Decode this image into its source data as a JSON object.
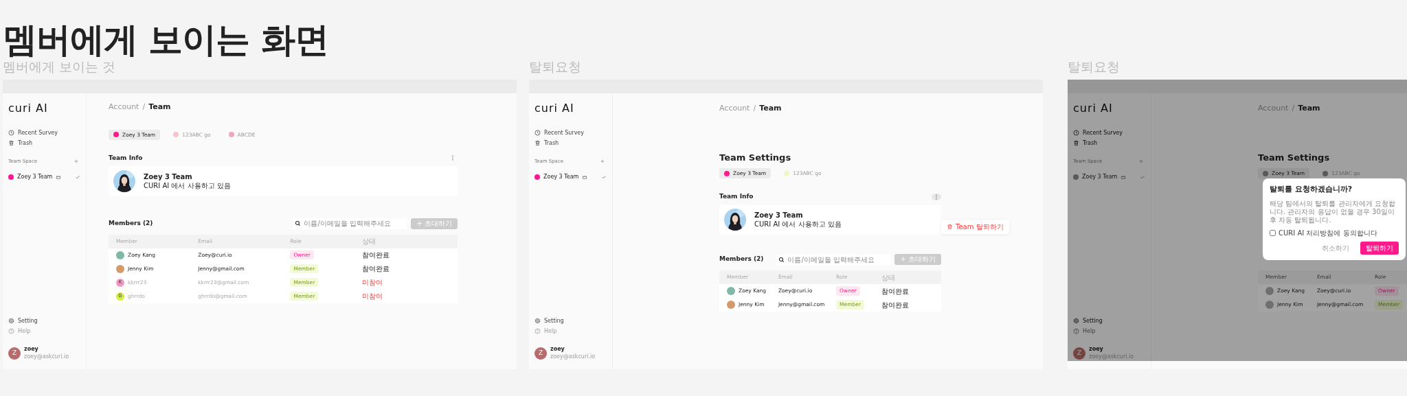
{
  "page_title": "멤버에게 보이는 화면",
  "boards": [
    {
      "label": "멤버에게 보이는 것",
      "app": {
        "sidebar": {
          "logo": "curi AI",
          "nav": [
            {
              "label": "Recent Survey",
              "kind": "clock"
            },
            {
              "label": "Trash",
              "kind": "trash"
            }
          ],
          "team_space": {
            "label": "Team Space",
            "teams": [
              {
                "name": "Zoey 3 Team",
                "color": "#ff1493",
                "owner": true,
                "selected": true
              }
            ]
          },
          "footer": [
            {
              "label": "Setting",
              "kind": "gear",
              "disabled": false
            },
            {
              "label": "Help",
              "kind": "help",
              "disabled": true
            }
          ],
          "user": {
            "initial": "Z",
            "name": "zoey",
            "email": "zoey@askcuri.io"
          }
        },
        "breadcrumb": {
          "items": [
            "Account",
            "Team"
          ],
          "separator": "/"
        },
        "main": {
          "team_tabs": [
            {
              "label": "Zoey 3 Team",
              "color": "#ff1a8c",
              "selected": true
            },
            {
              "label": "123ABC go",
              "color": "#f7c3cd",
              "selected": false
            },
            {
              "label": "ABCDE",
              "color": "#f3a6c4",
              "selected": false
            }
          ],
          "team_info": {
            "label": "Team Info",
            "name": "Zoey 3 Team",
            "description": "CURI AI 에서 사용하고 있음"
          },
          "members": {
            "title": "Members (2)",
            "search": {
              "placeholder": "이름/이메일을 입력해주세요"
            },
            "invite": {
              "label": "+ 초대하기",
              "disabled": true
            },
            "columns": [
              "Member",
              "Email",
              "Role",
              "상태"
            ],
            "rows": [
              {
                "name": "Zoey Kang",
                "email": "Zoey@curi.io",
                "role": {
                  "label": "Owner",
                  "kind": "owner"
                },
                "status": "참여완료",
                "joined": true
              },
              {
                "name": "Jenny Kim",
                "email": "Jenny@gmail.com",
                "role": {
                  "label": "Member",
                  "kind": "member"
                },
                "status": "참여완료",
                "joined": true
              },
              {
                "name": "kkrrr23",
                "email": "kkrrr23@gmail.com",
                "role": {
                  "label": "Member",
                  "kind": "member"
                },
                "status": "미참여",
                "joined": false,
                "avatar": {
                  "kind": "initial",
                  "initial": "K",
                  "color": "#f29ac4"
                }
              },
              {
                "name": "ghrrdo",
                "email": "ghrrdo@gmail.com",
                "role": {
                  "label": "Member",
                  "kind": "member"
                },
                "status": "미참여",
                "joined": false,
                "avatar": {
                  "kind": "initial",
                  "initial": "G",
                  "color": "#d4f03c"
                }
              }
            ]
          }
        }
      }
    },
    {
      "label": "탈퇴요청",
      "app": {
        "sidebar": {
          "logo": "curi AI",
          "nav": [
            {
              "label": "Recent Survey",
              "kind": "clock"
            },
            {
              "label": "Trash",
              "kind": "trash"
            }
          ],
          "team_space": {
            "label": "Team Space",
            "teams": [
              {
                "name": "Zoey 3 Team",
                "color": "#ff1493",
                "owner": true,
                "selected": true
              }
            ]
          },
          "footer": [
            {
              "label": "Setting",
              "kind": "gear",
              "disabled": false
            },
            {
              "label": "Help",
              "kind": "help",
              "disabled": true
            }
          ],
          "user": {
            "initial": "Z",
            "name": "zoey",
            "email": "zoey@askcuri.io"
          }
        },
        "breadcrumb": {
          "items": [
            "Account",
            "Team"
          ],
          "separator": "/"
        },
        "main": {
          "heading": "Team Settings",
          "team_tabs": [
            {
              "label": "Zoey 3 Team",
              "color": "#ff1a8c",
              "selected": true
            },
            {
              "label": "123ABC go",
              "color": "#eef7c6",
              "selected": false
            }
          ],
          "team_info": {
            "label": "Team Info",
            "name": "Zoey 3 Team",
            "description": "CURI AI 에서 사용하고 있음"
          },
          "leave_menu": {
            "label": "Team 탈퇴하기"
          },
          "members": {
            "title": "Members (2)",
            "search": {
              "placeholder": "이름/이메일을 입력해주세요"
            },
            "invite": {
              "label": "+ 초대하기",
              "disabled": true
            },
            "columns": [
              "Member",
              "Email",
              "Role",
              "상태"
            ],
            "rows": [
              {
                "name": "Zoey Kang",
                "email": "Zoey@curi.io",
                "role": {
                  "label": "Owner",
                  "kind": "owner"
                },
                "status": "참여완료",
                "joined": true
              },
              {
                "name": "Jenny Kim",
                "email": "Jenny@gmail.com",
                "role": {
                  "label": "Member",
                  "kind": "member"
                },
                "status": "참여완료",
                "joined": true
              }
            ]
          }
        }
      }
    },
    {
      "label": "탈퇴요청",
      "app": {
        "sidebar": {
          "logo": "curi AI",
          "nav": [
            {
              "label": "Recent Survey",
              "kind": "clock"
            },
            {
              "label": "Trash",
              "kind": "trash"
            }
          ],
          "team_space": {
            "label": "Team Space",
            "teams": [
              {
                "name": "Zoey 3 Team",
                "owner": true,
                "selected": true
              }
            ]
          },
          "footer": [
            {
              "label": "Setting",
              "kind": "gear",
              "disabled": false
            },
            {
              "label": "Help",
              "kind": "help",
              "disabled": true
            }
          ],
          "user": {
            "initial": "Z",
            "name": "zoey",
            "email": "zoey@askcuri.io"
          }
        },
        "breadcrumb": {
          "items": [
            "Account",
            "Team"
          ],
          "separator": "/"
        },
        "main": {
          "heading": "Team Settings",
          "team_tabs": [
            {
              "label": "Zoey 3 Team",
              "selected": true
            },
            {
              "label": "123ABC go",
              "selected": false
            }
          ],
          "members": {
            "columns": [
              "Member",
              "Email",
              "Role"
            ],
            "rows": [
              {
                "name": "Zoey Kang",
                "email": "Zoey@curi.io",
                "role": {
                  "label": "Owner",
                  "kind": "owner"
                }
              },
              {
                "name": "Jenny Kim",
                "email": "Jenny@gmail.com",
                "role": {
                  "label": "Member",
                  "kind": "member"
                }
              }
            ]
          }
        },
        "modal": {
          "title": "탈퇴를 요청하겠습니까?",
          "message": "해당 팀에서의 탈퇴를 관리자에게 요청합니다. 관리자의 응답이 없을 경우 30일이후 자동 탈퇴됩니다.",
          "checkbox": {
            "label": "CURI AI 처리방침에 동의합니다",
            "checked": false
          },
          "buttons": [
            {
              "label": "취소하기",
              "kind": "secondary"
            },
            {
              "label": "탈퇴하기",
              "kind": "primary"
            }
          ]
        }
      }
    }
  ]
}
